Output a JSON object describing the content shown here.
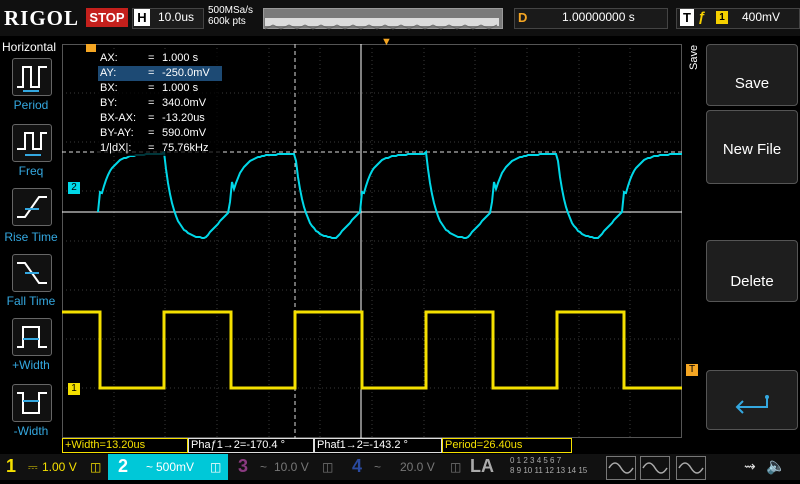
{
  "topbar": {
    "brand": "RIGOL",
    "run_state": "STOP",
    "horizontal_label": "H",
    "timebase": "10.0us",
    "sample_rate": "500MSa/s",
    "memory_depth": "600k pts",
    "delay_label": "D",
    "delay_value": "1.00000000 s",
    "trigger_label": "T",
    "trigger_edge": "ƒ",
    "trigger_channel": "1",
    "trigger_level": "400mV"
  },
  "left_menu": {
    "title": "Horizontal",
    "items": [
      {
        "label": "Period"
      },
      {
        "label": "Freq"
      },
      {
        "label": "Rise Time"
      },
      {
        "label": "Fall Time"
      },
      {
        "label": "+Width"
      },
      {
        "label": "-Width"
      }
    ]
  },
  "right_menu": {
    "title": "Save",
    "items": [
      {
        "label": "Save"
      },
      {
        "label": "New File"
      },
      {
        "label": "Delete"
      },
      {
        "label": ""
      }
    ]
  },
  "cursor_table": {
    "rows": [
      {
        "key": "AX:",
        "eq": "=",
        "val": "1.000 s"
      },
      {
        "key": "AY:",
        "eq": "=",
        "val": "-250.0mV"
      },
      {
        "key": "BX:",
        "eq": "=",
        "val": "1.000 s"
      },
      {
        "key": "BY:",
        "eq": "=",
        "val": "340.0mV"
      },
      {
        "key": "BX-AX:",
        "eq": "=",
        "val": "-13.20us"
      },
      {
        "key": "BY-AY:",
        "eq": "=",
        "val": "590.0mV"
      },
      {
        "key": "1/|dX|:",
        "eq": "=",
        "val": "75.76kHz"
      }
    ]
  },
  "channel_markers": {
    "ch1": "1",
    "ch2": "2",
    "trig": "T"
  },
  "measurements": [
    {
      "label": "+Width=13.20us"
    },
    {
      "label": "Phaƒ1→2=-170.4 °"
    },
    {
      "label": "Phaƭ1→2=-143.2 °"
    },
    {
      "label": "Period=26.40us"
    }
  ],
  "channels": [
    {
      "num": "1",
      "value": "1.00 V",
      "color": "#f5e000"
    },
    {
      "num": "2",
      "value": "500mV",
      "color": "#00d8e8"
    },
    {
      "num": "3",
      "value": "10.0 V",
      "color": "#d050c0"
    },
    {
      "num": "4",
      "value": "20.0 V",
      "color": "#3060e8"
    }
  ],
  "la_label": "LA",
  "la_digits_top": "0 1 2 3 4 5 6 7",
  "la_digits_bottom": "8 9 10 11 12 13 14 15",
  "colors": {
    "ch1": "#f5e000",
    "ch2": "#00d8e8",
    "accent": "#f5a623",
    "stop": "#c4201c"
  }
}
